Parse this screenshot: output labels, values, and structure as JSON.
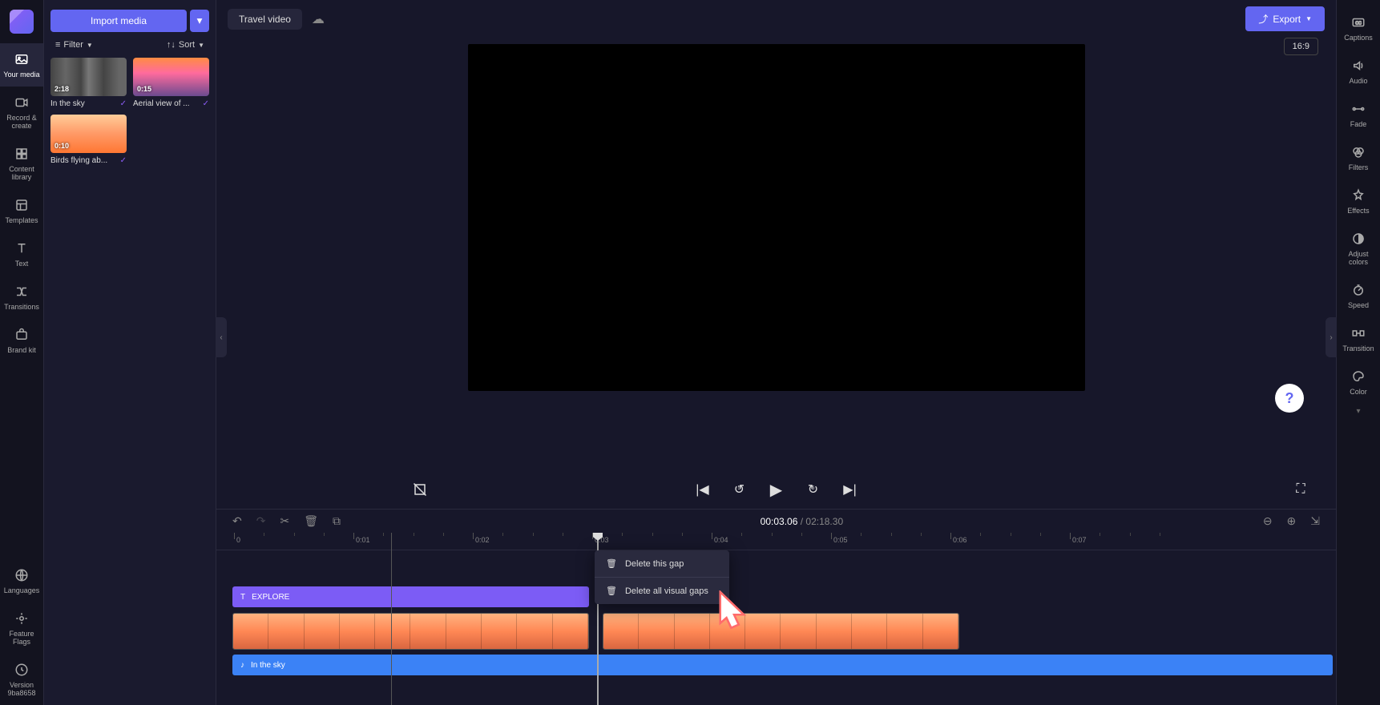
{
  "project_title": "Travel video",
  "import_button": "Import media",
  "filter_label": "Filter",
  "sort_label": "Sort",
  "export_label": "Export",
  "aspect_ratio": "16:9",
  "time_current": "00:03.06",
  "time_total": "02:18.30",
  "left_sidebar": [
    {
      "id": "your-media",
      "label": "Your media"
    },
    {
      "id": "record-create",
      "label": "Record & create"
    },
    {
      "id": "content-library",
      "label": "Content library"
    },
    {
      "id": "templates",
      "label": "Templates"
    },
    {
      "id": "text",
      "label": "Text"
    },
    {
      "id": "transitions",
      "label": "Transitions"
    },
    {
      "id": "brand-kit",
      "label": "Brand kit"
    }
  ],
  "left_sidebar_bottom": [
    {
      "id": "languages",
      "label": "Languages"
    },
    {
      "id": "feature-flags",
      "label": "Feature Flags"
    },
    {
      "id": "version",
      "label": "Version 9ba8658"
    }
  ],
  "right_sidebar": [
    {
      "id": "captions",
      "label": "Captions"
    },
    {
      "id": "audio",
      "label": "Audio"
    },
    {
      "id": "fade",
      "label": "Fade"
    },
    {
      "id": "filters",
      "label": "Filters"
    },
    {
      "id": "effects",
      "label": "Effects"
    },
    {
      "id": "adjust-colors",
      "label": "Adjust colors"
    },
    {
      "id": "speed",
      "label": "Speed"
    },
    {
      "id": "transition",
      "label": "Transition"
    },
    {
      "id": "color",
      "label": "Color"
    }
  ],
  "media_items": [
    {
      "duration": "2:18",
      "label": "In the sky",
      "thumb_class": "waveform"
    },
    {
      "duration": "0:15",
      "label": "Aerial view of ...",
      "thumb_class": "landscape"
    },
    {
      "duration": "0:10",
      "label": "Birds flying ab...",
      "thumb_class": "birds"
    }
  ],
  "ruler_marks": [
    "0",
    "0:01",
    "0:02",
    "0:03",
    "0:04",
    "0:05",
    "0:06",
    "0:07"
  ],
  "text_clip_label": "EXPLORE",
  "audio_clip_label": "In the sky",
  "context_menu": {
    "delete_gap": "Delete this gap",
    "delete_all_gaps": "Delete all visual gaps"
  },
  "skip_back": "5",
  "skip_fwd": "5"
}
